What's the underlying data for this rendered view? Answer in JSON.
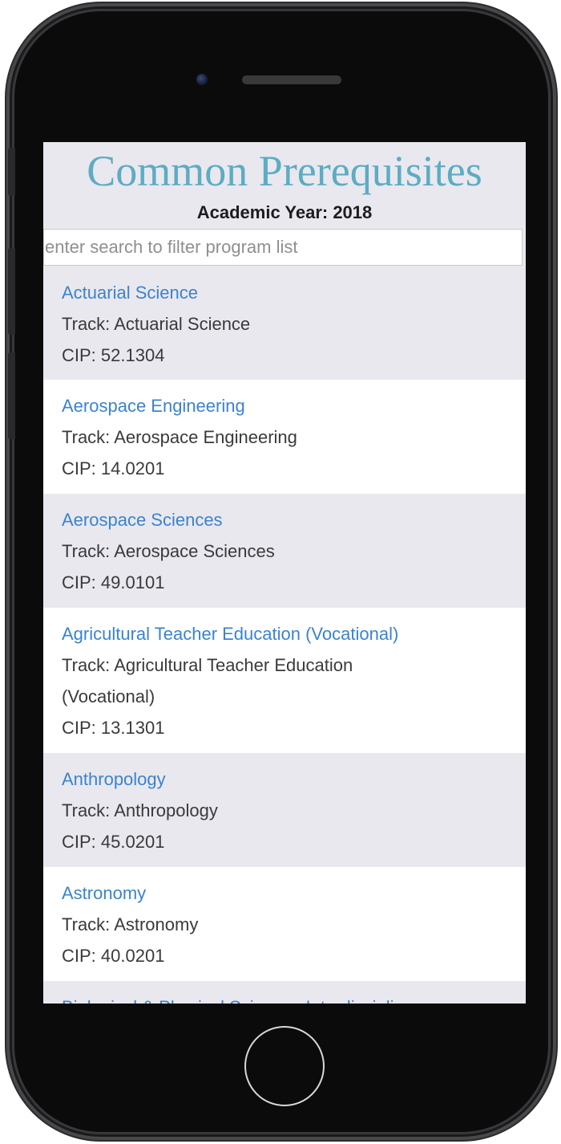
{
  "header": {
    "title": "Common Prerequisites",
    "academic_year": "Academic Year: 2018"
  },
  "search": {
    "placeholder": "enter search to filter program list",
    "value": ""
  },
  "programs": [
    {
      "name": "Actuarial Science",
      "track": "Track: Actuarial Science",
      "cip": "CIP: 52.1304"
    },
    {
      "name": "Aerospace Engineering",
      "track": "Track: Aerospace Engineering",
      "cip": "CIP: 14.0201"
    },
    {
      "name": "Aerospace Sciences",
      "track": "Track: Aerospace Sciences",
      "cip": "CIP: 49.0101"
    },
    {
      "name": "Agricultural Teacher Education (Vocational)",
      "track": "Track: Agricultural Teacher Education (Vocational)",
      "cip": "CIP: 13.1301"
    },
    {
      "name": "Anthropology",
      "track": "Track: Anthropology",
      "cip": "CIP: 45.0201"
    },
    {
      "name": "Astronomy",
      "track": "Track: Astronomy",
      "cip": "CIP: 40.0201"
    },
    {
      "name": "Biological & Physical Sciences Interdisciplinary",
      "track": "",
      "cip": ""
    }
  ],
  "colors": {
    "title": "#5cacc4",
    "link": "#3b83cf",
    "stripe": "#e9e8ee",
    "phone_body": "#0b0b0c"
  },
  "icons": {
    "camera": "front-camera-icon",
    "speaker": "earpiece-speaker-icon",
    "home": "home-button-icon"
  }
}
